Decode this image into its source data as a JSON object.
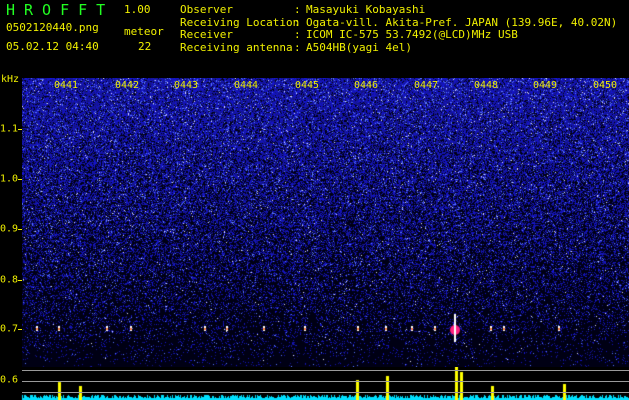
{
  "header": {
    "app_title": "HROFFT",
    "version": "1.00",
    "filename": "0502120440.png",
    "mode_label": "meteor",
    "datetime": "05.02.12 04:40",
    "meteor_count": "22"
  },
  "meta": [
    {
      "key": "Observer",
      "value": "Masayuki Kobayashi"
    },
    {
      "key": "Receiving Location",
      "value": "Ogata-vill. Akita-Pref. JAPAN (139.96E, 40.02N)"
    },
    {
      "key": "Receiver",
      "value": "ICOM IC-575 53.7492(@LCD)MHz USB"
    },
    {
      "key": "Receiving antenna",
      "value": "A504HB(yagi 4el)"
    }
  ],
  "axes": {
    "unit_label": "kHz",
    "time_labels": [
      "0441",
      "0442",
      "0443",
      "0444",
      "0445",
      "0446",
      "0447",
      "0448",
      "0449",
      "0450"
    ],
    "freq_labels": [
      "1.1",
      "1.0",
      "0.9",
      "0.8",
      "0.7",
      "0.6"
    ]
  },
  "colors": {
    "text": "#f0f000",
    "title": "#22ff22",
    "noise": "#1a1aa0",
    "echo": "#ff2080",
    "strip_base": "#00ffff",
    "strip_peak": "#ffff00"
  }
}
